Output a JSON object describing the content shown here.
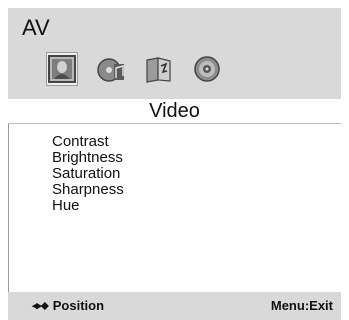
{
  "header": {
    "title": "AV"
  },
  "tabs": [
    {
      "icon": "picture-icon",
      "selected": true
    },
    {
      "icon": "audio-disc-icon",
      "selected": false
    },
    {
      "icon": "language-icon",
      "selected": false
    },
    {
      "icon": "settings-gear-icon",
      "selected": false
    }
  ],
  "section": {
    "title": "Video"
  },
  "menu": {
    "items": [
      {
        "label": "Contrast"
      },
      {
        "label": "Brightness"
      },
      {
        "label": "Saturation"
      },
      {
        "label": "Sharpness"
      },
      {
        "label": "Hue"
      }
    ]
  },
  "status": {
    "arrows": "◂▸⬥",
    "position_hint": "Position",
    "exit_hint": "Menu:Exit"
  }
}
